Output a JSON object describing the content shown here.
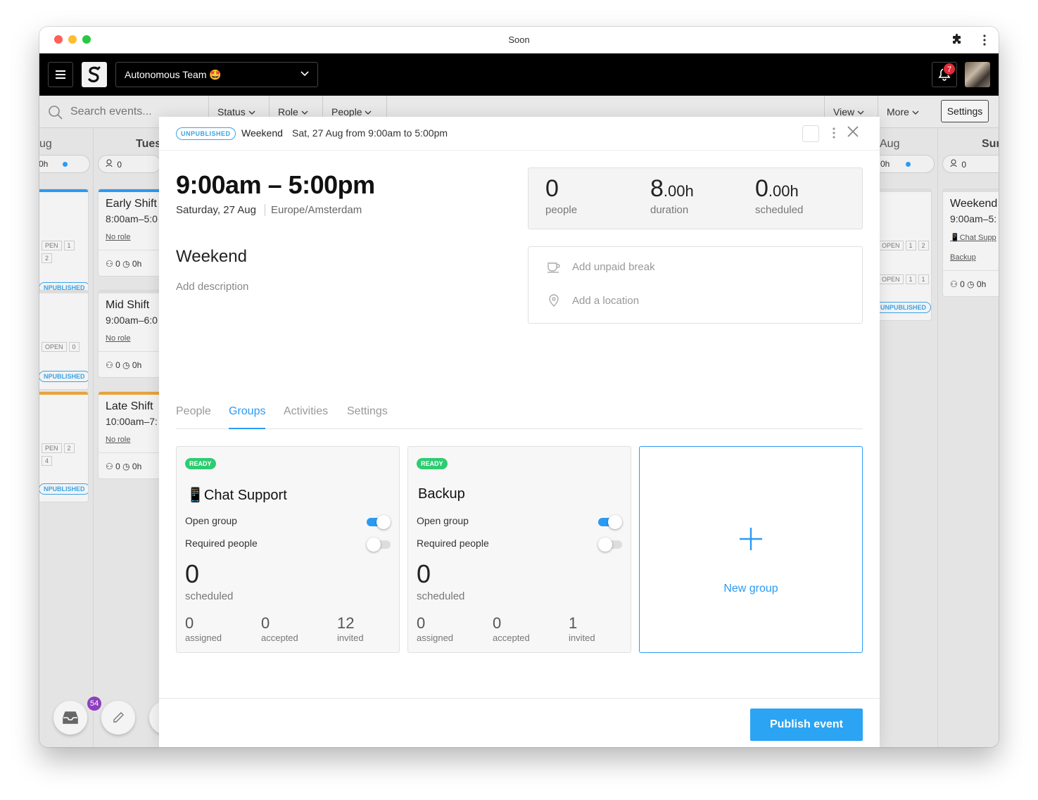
{
  "window": {
    "title": "Soon"
  },
  "topbar": {
    "team_name": "Autonomous Team 🤩",
    "notifications_count": "7"
  },
  "filters": {
    "search_placeholder": "Search events...",
    "status": "Status",
    "role": "Role",
    "people": "People",
    "view": "View",
    "more": "More",
    "settings": "Settings"
  },
  "board": {
    "left_col": {
      "day": "ug",
      "pill_hours": "0h"
    },
    "tues_col": {
      "day": "Tues",
      "pill_people": "0"
    },
    "right_col": {
      "day": "Aug",
      "pill_hours": "0h"
    },
    "sun_col": {
      "day": "Sur",
      "pill_people": "0"
    },
    "left_cards": [
      {
        "tags": [
          "PEN",
          "1",
          "2"
        ],
        "status": "NPUBLISHED"
      },
      {
        "tags": [
          "OPEN",
          "0"
        ],
        "status": "NPUBLISHED"
      },
      {
        "tags": [
          "PEN",
          "2",
          "4"
        ],
        "status": "NPUBLISHED"
      }
    ],
    "tues_cards": [
      {
        "title": "Early Shift",
        "time": "8:00am–5:0",
        "role": "No role",
        "people": "0",
        "hours": "0h"
      },
      {
        "title": "Mid Shift",
        "time": "9:00am–6:0",
        "role": "No role",
        "people": "0",
        "hours": "0h"
      },
      {
        "title": "Late Shift",
        "time": "10:00am–7:",
        "role": "No role",
        "people": "0",
        "hours": "0h"
      }
    ],
    "right_cards": [
      {
        "tags": [
          "OPEN",
          "1",
          "2"
        ]
      },
      {
        "tags": [
          "OPEN",
          "1",
          "1"
        ],
        "status": "UNPUBLISHED"
      }
    ],
    "sun_card": {
      "title": "Weekend",
      "time": "9:00am–5:",
      "group1": "📱Chat Supp",
      "group2": "Backup",
      "people": "0",
      "hours": "0h"
    },
    "inbox_count": "54"
  },
  "modal": {
    "status": "UNPUBLISHED",
    "name": "Weekend",
    "when": "Sat, 27 Aug from 9:00am to 5:00pm",
    "time_range": "9:00am – 5:00pm",
    "date": "Saturday, 27 Aug",
    "timezone": "Europe/Amsterdam",
    "stats": {
      "people": "0",
      "people_label": "people",
      "duration_int": "8",
      "duration_dec": ".00h",
      "duration_label": "duration",
      "scheduled_int": "0",
      "scheduled_dec": ".00h",
      "scheduled_label": "scheduled"
    },
    "break_label": "Add unpaid break",
    "location_label": "Add a location",
    "title": "Weekend",
    "description_placeholder": "Add description",
    "tabs": [
      "People",
      "Groups",
      "Activities",
      "Settings"
    ],
    "active_tab": "Groups",
    "groups": [
      {
        "status": "READY",
        "name": "📱Chat Support",
        "open_label": "Open group",
        "open": true,
        "required_label": "Required people",
        "required": false,
        "scheduled": "0",
        "scheduled_label": "scheduled",
        "assigned": "0",
        "assigned_label": "assigned",
        "accepted": "0",
        "accepted_label": "accepted",
        "invited": "12",
        "invited_label": "invited"
      },
      {
        "status": "READY",
        "name": "Backup",
        "open_label": "Open group",
        "open": true,
        "required_label": "Required people",
        "required": false,
        "scheduled": "0",
        "scheduled_label": "scheduled",
        "assigned": "0",
        "assigned_label": "assigned",
        "accepted": "0",
        "accepted_label": "accepted",
        "invited": "1",
        "invited_label": "invited"
      }
    ],
    "new_group_label": "New group",
    "publish_label": "Publish event"
  },
  "colors": {
    "accent": "#2b9af3",
    "ready": "#2ecc71",
    "badge": "#e02b3a",
    "tues_bar_1": "#2b9af3",
    "tues_bar_3": "#e8a23a"
  }
}
